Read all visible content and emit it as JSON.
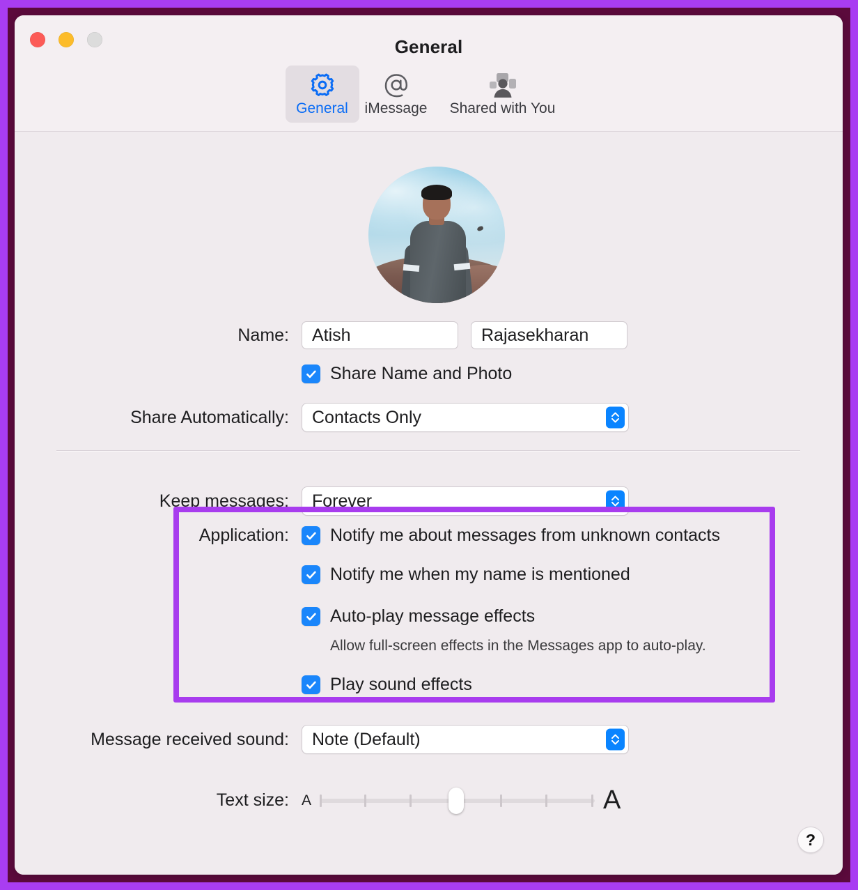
{
  "window": {
    "title": "General",
    "traffic_lights": [
      {
        "name": "close",
        "color": "#fc5b57"
      },
      {
        "name": "minimize",
        "color": "#fcbc2a"
      },
      {
        "name": "zoom",
        "color": "#dcdcdc"
      }
    ]
  },
  "toolbar": {
    "tabs": [
      {
        "label": "General",
        "icon": "gear-icon",
        "selected": true
      },
      {
        "label": "iMessage",
        "icon": "at-sign-icon",
        "selected": false
      },
      {
        "label": "Shared with You",
        "icon": "shared-with-you-icon",
        "selected": false
      }
    ]
  },
  "profile": {
    "avatar_alt": "user profile photo",
    "name_label": "Name:",
    "first_name": "Atish",
    "last_name": "Rajasekharan",
    "share_name_photo_label": "Share Name and Photo",
    "share_name_photo_checked": true,
    "share_automatically_label": "Share Automatically:",
    "share_automatically_value": "Contacts Only"
  },
  "messages": {
    "keep_messages_label": "Keep messages:",
    "keep_messages_value": "Forever",
    "application_label": "Application:",
    "options": [
      {
        "label": "Notify me about messages from unknown contacts",
        "checked": true,
        "note": ""
      },
      {
        "label": "Notify me when my name is mentioned",
        "checked": true,
        "note": ""
      },
      {
        "label": "Auto-play message effects",
        "checked": true,
        "note": "Allow full-screen effects in the Messages app to auto-play."
      },
      {
        "label": "Play sound effects",
        "checked": true,
        "note": ""
      }
    ],
    "received_sound_label": "Message received sound:",
    "received_sound_value": "Note (Default)",
    "text_size_label": "Text size:",
    "text_size_min_glyph": "A",
    "text_size_max_glyph": "A",
    "text_size_ticks": 7,
    "text_size_position": 4
  },
  "help": {
    "glyph": "?"
  },
  "annotation": {
    "highlight_color": "#a83cee",
    "frame_color": "#a93df2",
    "backdrop_color": "#5b0a3c"
  }
}
